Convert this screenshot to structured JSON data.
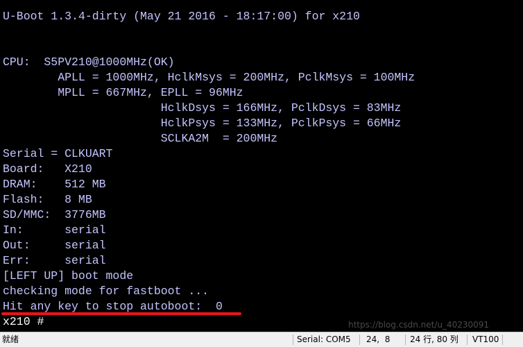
{
  "terminal": {
    "lines": [
      "U-Boot 1.3.4-dirty (May 21 2016 - 18:17:00) for x210",
      "",
      "",
      "CPU:  S5PV210@1000MHz(OK)",
      "        APLL = 1000MHz, HclkMsys = 200MHz, PclkMsys = 100MHz",
      "        MPLL = 667MHz, EPLL = 96MHz",
      "                       HclkDsys = 166MHz, PclkDsys = 83MHz",
      "                       HclkPsys = 133MHz, PclkPsys = 66MHz",
      "                       SCLKA2M  = 200MHz",
      "Serial = CLKUART",
      "Board:   X210",
      "DRAM:    512 MB",
      "Flash:   8 MB",
      "SD/MMC:  3776MB",
      "In:      serial",
      "Out:     serial",
      "Err:     serial",
      "[LEFT UP] boot mode",
      "checking mode for fastboot ...",
      "Hit any key to stop autoboot:  0",
      "x210 #"
    ],
    "text_color": "#c4c4ff",
    "prompt_color": "#ffffff",
    "background": "#000000",
    "highlight_color": "#e8141c"
  },
  "watermark": "https://blog.csdn.net/u_40230091",
  "statusbar": {
    "state": "就绪",
    "connection": "Serial: COM5",
    "cursor": "24,  8",
    "size": "24 行, 80 列",
    "terminal_type": "VT100"
  }
}
